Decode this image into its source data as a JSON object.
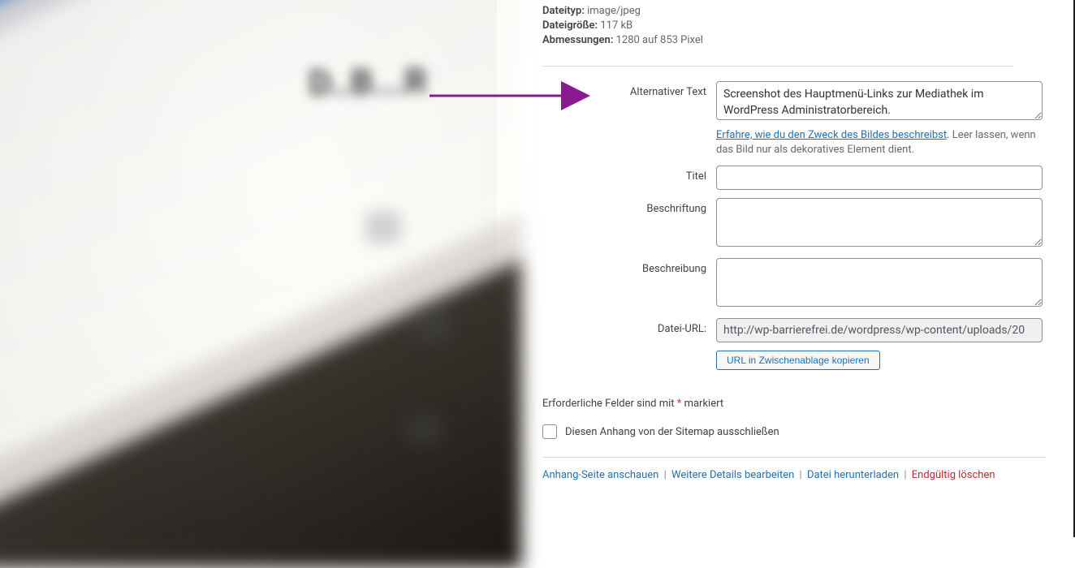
{
  "meta": {
    "filetype_label": "Dateityp:",
    "filetype_value": "image/jpeg",
    "filesize_label": "Dateigröße:",
    "filesize_value": "117 kB",
    "dimensions_label": "Abmessungen:",
    "dimensions_value": "1280 auf 853 Pixel"
  },
  "fields": {
    "alt": {
      "label": "Alternativer Text",
      "value": "Screenshot des Hauptmenü-Links zur Mediathek im WordPress Administratorbereich.",
      "hint_link": "Erfahre, wie du den Zweck des Bildes beschreibst",
      "hint_rest": ". Leer lassen, wenn das Bild nur als dekoratives Element dient."
    },
    "title": {
      "label": "Titel",
      "value": ""
    },
    "caption": {
      "label": "Beschriftung",
      "value": ""
    },
    "description": {
      "label": "Beschreibung",
      "value": ""
    },
    "fileurl": {
      "label": "Datei-URL:",
      "value": "http://wp-barrierefrei.de/wordpress/wp-content/uploads/20",
      "copy_button": "URL in Zwischenablage kopieren"
    }
  },
  "required": {
    "prefix": "Erforderliche Felder sind mit ",
    "star": "*",
    "suffix": " markiert"
  },
  "sitemap": {
    "label": "Diesen Anhang von der Sitemap ausschließen"
  },
  "actions": {
    "view": "Anhang-Seite anschauen",
    "edit": "Weitere Details bearbeiten",
    "download": "Datei herunterladen",
    "delete": "Endgültig löschen"
  },
  "annotation_color": "#8a1a8f"
}
